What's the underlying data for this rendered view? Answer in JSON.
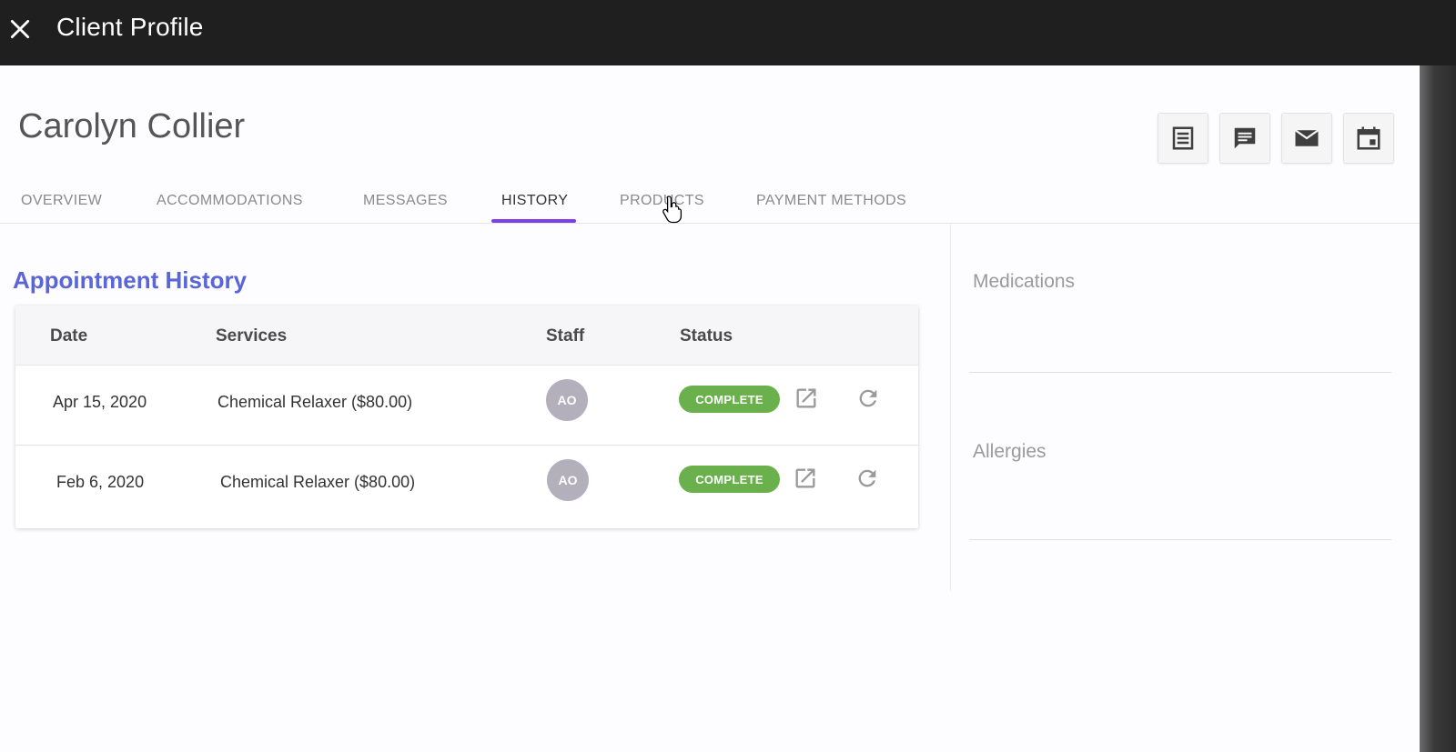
{
  "topbar": {
    "title": "Client Profile"
  },
  "client": {
    "name": "Carolyn Collier"
  },
  "actions": [
    {
      "name": "notes-button",
      "icon": "notes-icon"
    },
    {
      "name": "message-button",
      "icon": "chat-icon"
    },
    {
      "name": "email-button",
      "icon": "email-icon"
    },
    {
      "name": "calendar-button",
      "icon": "calendar-icon"
    }
  ],
  "tabs": [
    {
      "label": "OVERVIEW"
    },
    {
      "label": "ACCOMMODATIONS"
    },
    {
      "label": "MESSAGES"
    },
    {
      "label": "HISTORY",
      "active": true
    },
    {
      "label": "PRODUCTS"
    },
    {
      "label": "PAYMENT METHODS"
    }
  ],
  "history": {
    "title": "Appointment History",
    "columns": {
      "date": "Date",
      "services": "Services",
      "staff": "Staff",
      "status": "Status"
    },
    "rows": [
      {
        "date": "Apr 15, 2020",
        "service": "Chemical Relaxer ($80.00)",
        "staff": "AO",
        "status": "COMPLETE"
      },
      {
        "date": "Feb 6, 2020",
        "service": "Chemical Relaxer ($80.00)",
        "staff": "AO",
        "status": "COMPLETE"
      }
    ]
  },
  "side": {
    "medications": "Medications",
    "allergies": "Allergies"
  },
  "colors": {
    "accent": "#7b3fe4",
    "link": "#5b66d6",
    "complete": "#6ab04c",
    "topbar": "#1f1f1f"
  }
}
